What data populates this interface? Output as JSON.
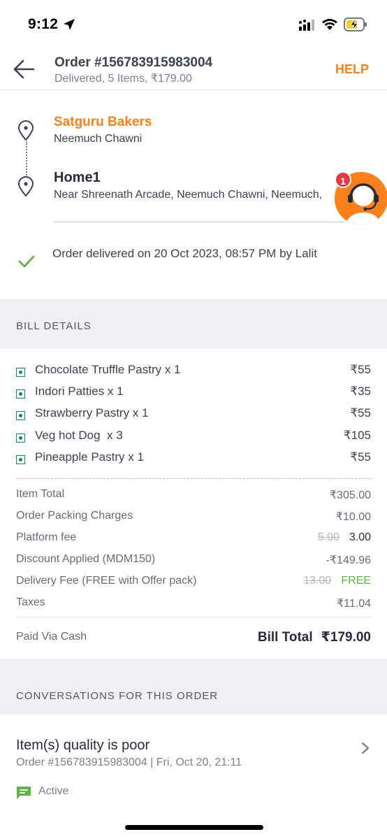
{
  "status_bar": {
    "time": "9:12"
  },
  "header": {
    "title": "Order #156783915983004",
    "subtitle": "Delivered, 5 Items, ₹179.00",
    "help_label": "HELP"
  },
  "route": {
    "restaurant_name": "Satguru Bakers",
    "restaurant_area": "Neemuch Chawni",
    "home_name": "Home1",
    "home_address": "Near Shreenath Arcade, Neemuch Chawni, Neemuch,",
    "delivered_text": "Order delivered on 20 Oct 2023, 08:57 PM by Lalit"
  },
  "support": {
    "badge_count": "1"
  },
  "bill": {
    "section_label": "BILL DETAILS",
    "items": [
      {
        "name": "Chocolate Truffle Pastry x 1",
        "price": "₹55"
      },
      {
        "name": "Indori Patties x 1",
        "price": "₹35"
      },
      {
        "name": "Strawberry Pastry x 1",
        "price": "₹55"
      },
      {
        "name": "Veg hot Dog  x 3",
        "price": "₹105"
      },
      {
        "name": "Pineapple Pastry x 1",
        "price": "₹55"
      }
    ],
    "charges": {
      "item_total_label": "Item Total",
      "item_total_value": "₹305.00",
      "packing_label": "Order Packing Charges",
      "packing_value": "₹10.00",
      "platform_label": "Platform fee",
      "platform_original": "5.00",
      "platform_value": "3.00",
      "discount_label": "Discount Applied (MDM150)",
      "discount_value": "-₹149.96",
      "delivery_label": "Delivery Fee (FREE with Offer pack)",
      "delivery_original": "13.00",
      "delivery_value": "FREE",
      "taxes_label": "Taxes",
      "taxes_value": "₹11.04"
    },
    "paid_via": "Paid Via Cash",
    "total_label": "Bill Total",
    "total_value": "₹179.00"
  },
  "conversations": {
    "section_label": "CONVERSATIONS FOR THIS ORDER",
    "title": "Item(s) quality is poor",
    "subtitle": "Order #156783915983004 | Fri, Oct 20, 21:11",
    "status": "Active"
  },
  "colors": {
    "accent": "#fc8019",
    "veg": "#0f8a65",
    "success": "#60b246",
    "section_bg": "#f0f0f5",
    "badge": "#e23744"
  },
  "icons": [
    "location-arrow-icon",
    "signal-icon",
    "wifi-icon",
    "battery-charging-icon",
    "back-arrow-icon",
    "map-pin-icon",
    "check-icon",
    "support-agent-icon",
    "veg-icon",
    "chevron-right-icon",
    "chat-icon"
  ]
}
